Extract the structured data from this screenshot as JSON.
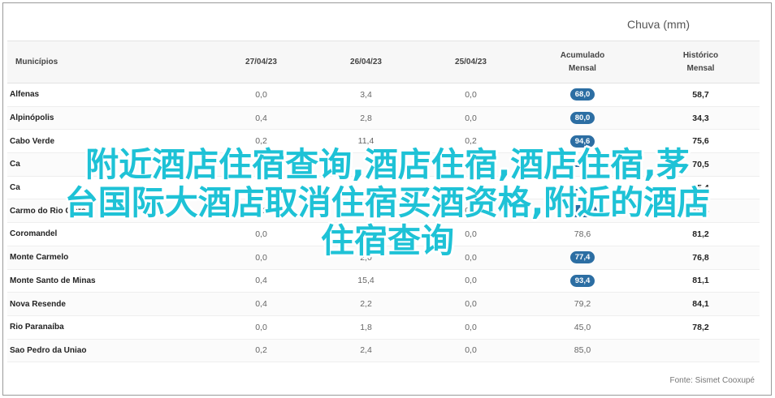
{
  "unit_caption": "Chuva (mm)",
  "headers": {
    "municipio": "Municípios",
    "d1": "27/04/23",
    "d2": "26/04/23",
    "d3": "25/04/23",
    "acum_l1": "Acumulado",
    "acum_l2": "Mensal",
    "hist_l1": "Histórico",
    "hist_l2": "Mensal"
  },
  "rows": [
    {
      "name": "Alfenas",
      "d1": "0,0",
      "d2": "3,4",
      "d3": "0,0",
      "acum": "68,0",
      "acum_highlight": true,
      "hist": "58,7"
    },
    {
      "name": "Alpinópolis",
      "d1": "0,4",
      "d2": "2,8",
      "d3": "0,0",
      "acum": "80,0",
      "acum_highlight": true,
      "hist": "34,3"
    },
    {
      "name": "Cabo Verde",
      "d1": "0,2",
      "d2": "11,4",
      "d3": "0,2",
      "acum": "94,6",
      "acum_highlight": true,
      "hist": "75,6"
    },
    {
      "name": "Ca",
      "d1": "",
      "d2": "",
      "d3": "",
      "acum": "",
      "acum_highlight": true,
      "hist": "70,5"
    },
    {
      "name": "Ca",
      "d1": "",
      "d2": "",
      "d3": "",
      "acum": "",
      "acum_highlight": true,
      "hist": "75,4"
    },
    {
      "name": "Carmo do Rio Claro",
      "d1": "0,2",
      "d2": "",
      "d3": "0,0",
      "acum": "145,8",
      "acum_highlight": true,
      "hist": "89,4"
    },
    {
      "name": "Coromandel",
      "d1": "0,0",
      "d2": "",
      "d3": "0,0",
      "acum": "78,6",
      "acum_highlight": false,
      "hist": "81,2"
    },
    {
      "name": "Monte Carmelo",
      "d1": "0,0",
      "d2": "2,0",
      "d3": "0,0",
      "acum": "77,4",
      "acum_highlight": true,
      "hist": "76,8"
    },
    {
      "name": "Monte Santo de Minas",
      "d1": "0,4",
      "d2": "15,4",
      "d3": "0,0",
      "acum": "93,4",
      "acum_highlight": true,
      "hist": "81,1"
    },
    {
      "name": "Nova Resende",
      "d1": "0,4",
      "d2": "2,2",
      "d3": "0,0",
      "acum": "79,2",
      "acum_highlight": false,
      "hist": "84,1"
    },
    {
      "name": "Rio Paranaíba",
      "d1": "0,0",
      "d2": "1,8",
      "d3": "0,0",
      "acum": "45,0",
      "acum_highlight": false,
      "hist": "78,2"
    },
    {
      "name": "Sao Pedro da Uniao",
      "d1": "0,2",
      "d2": "2,4",
      "d3": "0,0",
      "acum": "85,0",
      "acum_highlight": false,
      "hist": ""
    }
  ],
  "source": "Fonte: Sismet Cooxupé",
  "overlay": {
    "line1": "附近酒店住宿查询,酒店住宿,酒店住宿,茅",
    "line2": "台国际大酒店取消住宿买酒资格,附近的酒店",
    "line3": "住宿查询"
  }
}
